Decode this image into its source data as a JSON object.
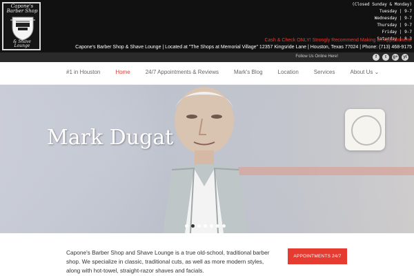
{
  "header": {
    "logo": {
      "top_text": "Capone's Barber Shop",
      "bottom_text": "& Shave Lounge"
    },
    "hours": [
      {
        "label": "(Closed Sunday & Monday)",
        "value": ""
      },
      {
        "label": "Tuesday",
        "value": "9-7"
      },
      {
        "label": "Wednesday",
        "value": "9-7"
      },
      {
        "label": "Thursday",
        "value": "9-7"
      },
      {
        "label": "Friday",
        "value": "9-7"
      },
      {
        "label": "Saturday",
        "value": "8-3"
      }
    ],
    "cash_line": "Cash & Check ONLY!  Strongly Recommend Making an Appointment!",
    "address_line": "Capone's Barber Shop & Shave Lounge | Located at \"The Shops at Memorial Village\"  12357 Kingsride Lane | Houston, Texas 77024 | Phone: (713) 468-9175"
  },
  "followbar": {
    "text": "Follow Us Online Here!",
    "social": [
      "f",
      "t",
      "g+",
      "yt"
    ]
  },
  "nav": {
    "items": [
      {
        "label": "#1 in Houston",
        "active": false
      },
      {
        "label": "Home",
        "active": true
      },
      {
        "label": "24/7 Appointments & Reviews",
        "active": false
      },
      {
        "label": "Mark's Blog",
        "active": false
      },
      {
        "label": "Location",
        "active": false
      },
      {
        "label": "Services",
        "active": false
      },
      {
        "label": "About Us",
        "active": false,
        "has_dropdown": true
      }
    ]
  },
  "hero": {
    "title": "Mark Dugat",
    "dots": 7,
    "active_dot": 2
  },
  "content": {
    "paragraph": "Capone's Barber Shop and Shave Lounge is a true old-school, traditional barber shop. We specialize in classic, traditional cuts, as well as more modern styles, along with hot-towel, straight-razor shaves and facials."
  },
  "cta": {
    "button_label": "APPOINTMENTS 24/7"
  },
  "colors": {
    "accent": "#e53b31",
    "header_bg": "#111111"
  }
}
